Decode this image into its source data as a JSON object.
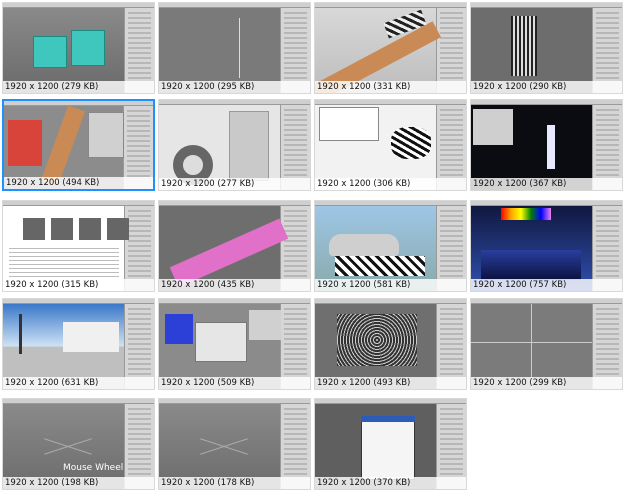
{
  "thumbnails": [
    {
      "caption": "1920 x 1200 (279 KB)",
      "selected": false,
      "scene": "cubes"
    },
    {
      "caption": "1920 x 1200 (295 KB)",
      "selected": false,
      "scene": "gray-viewport"
    },
    {
      "caption": "1920 x 1200 (331 KB)",
      "selected": false,
      "scene": "branch-zebra"
    },
    {
      "caption": "1920 x 1200 (290 KB)",
      "selected": false,
      "scene": "zebra-panel"
    },
    {
      "caption": "1920 x 1200 (494 KB)",
      "selected": true,
      "scene": "tree-editor"
    },
    {
      "caption": "1920 x 1200 (277 KB)",
      "selected": false,
      "scene": "ring-object"
    },
    {
      "caption": "1920 x 1200 (306 KB)",
      "selected": false,
      "scene": "zebra-rug"
    },
    {
      "caption": "1920 x 1200 (367 KB)",
      "selected": false,
      "scene": "dark-material"
    },
    {
      "caption": "1920 x 1200 (315 KB)",
      "selected": false,
      "scene": "document"
    },
    {
      "caption": "1920 x 1200 (435 KB)",
      "selected": false,
      "scene": "pink-branch"
    },
    {
      "caption": "1920 x 1200 (581 KB)",
      "selected": false,
      "scene": "car-render"
    },
    {
      "caption": "1920 x 1200 (757 KB)",
      "selected": false,
      "scene": "night-sky"
    },
    {
      "caption": "1920 x 1200 (631 KB)",
      "selected": false,
      "scene": "palm-hotel"
    },
    {
      "caption": "1920 x 1200 (509 KB)",
      "selected": false,
      "scene": "blue-scene"
    },
    {
      "caption": "1920 x 1200 (493 KB)",
      "selected": false,
      "scene": "noisy-render"
    },
    {
      "caption": "1920 x 1200 (299 KB)",
      "selected": false,
      "scene": "quad-viewport"
    },
    {
      "caption": "1920 x 1200 (198 KB)",
      "selected": false,
      "scene": "empty-grid",
      "overlay": "Mouse Wheel"
    },
    {
      "caption": "1920 x 1200 (178 KB)",
      "selected": false,
      "scene": "empty-grid"
    },
    {
      "caption": "1920 x 1200 (370 KB)",
      "selected": false,
      "scene": "dialog"
    }
  ],
  "colors": {
    "selected_border": "#1e90ff",
    "cube": "#3fc7bd",
    "zebra": "#2a2a2a",
    "pink": "#e070c8",
    "wood": "#c98a55",
    "blue": "#2c3fd6"
  },
  "icons": {
    "scene_placeholder": "viewport-icon"
  }
}
